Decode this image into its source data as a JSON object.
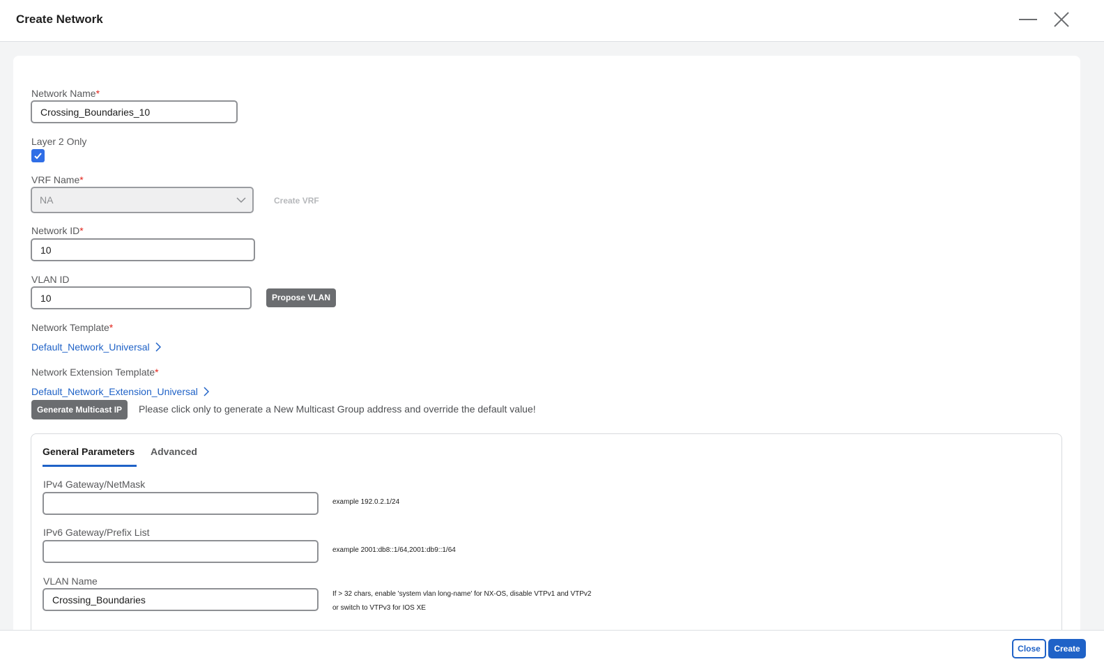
{
  "window": {
    "title": "Create Network",
    "minimize_icon": "minimize-icon",
    "close_icon": "close-icon"
  },
  "form": {
    "network_name": {
      "label": "Network Name",
      "required": "*",
      "value": "Crossing_Boundaries_10"
    },
    "layer2_only": {
      "label": "Layer 2 Only",
      "checked": true
    },
    "vrf_name": {
      "label": "VRF Name",
      "required": "*",
      "value": "NA",
      "create_vrf_label": "Create VRF"
    },
    "network_id": {
      "label": "Network ID",
      "required": "*",
      "value": "10"
    },
    "vlan_id": {
      "label": "VLAN ID",
      "value": "10",
      "propose_label": "Propose VLAN"
    },
    "network_template": {
      "label": "Network Template",
      "required": "*",
      "value": "Default_Network_Universal"
    },
    "network_extension_template": {
      "label": "Network Extension Template",
      "required": "*",
      "value": "Default_Network_Extension_Universal"
    },
    "multicast": {
      "button_label": "Generate Multicast IP",
      "note": "Please click only to generate a New Multicast Group address and override the default value!"
    }
  },
  "tabs": [
    {
      "label": "General Parameters",
      "active": true
    },
    {
      "label": "Advanced",
      "active": false
    }
  ],
  "general": {
    "ipv4": {
      "label": "IPv4 Gateway/NetMask",
      "value": "",
      "hint": "example 192.0.2.1/24"
    },
    "ipv6": {
      "label": "IPv6 Gateway/Prefix List",
      "value": "",
      "hint": "example 2001:db8::1/64,2001:db9::1/64"
    },
    "vlan_name": {
      "label": "VLAN Name",
      "value": "Crossing_Boundaries",
      "hint_line1": "If > 32 chars, enable 'system vlan long-name' for NX-OS, disable VTPv1 and VTPv2",
      "hint_line2": "or switch to VTPv3 for IOS XE"
    }
  },
  "footer": {
    "close_label": "Close",
    "create_label": "Create"
  },
  "colors": {
    "accent": "#1f62c7",
    "checkbox": "#2f6ee6",
    "required": "#e2231a",
    "gray_button": "#6b6d70"
  }
}
